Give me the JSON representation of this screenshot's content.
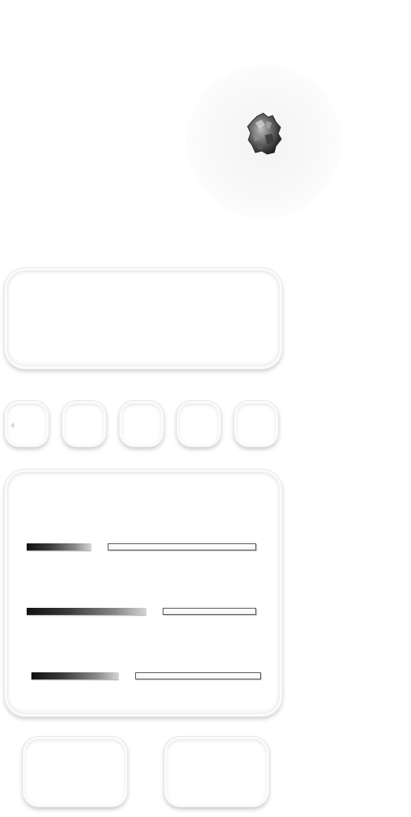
{
  "sliders": [
    {
      "id": "slider-1",
      "value": 0.28
    },
    {
      "id": "slider-2",
      "value": 0.52
    },
    {
      "id": "slider-3",
      "value": 0.38
    }
  ],
  "small_buttons": [
    {
      "id": "small-button-1"
    },
    {
      "id": "small-button-2"
    },
    {
      "id": "small-button-3"
    },
    {
      "id": "small-button-4"
    },
    {
      "id": "small-button-5"
    }
  ],
  "big_buttons": [
    {
      "id": "big-button-left"
    },
    {
      "id": "big-button-right"
    }
  ],
  "icons": {
    "rock": "rock-icon",
    "arrow": "arrow-left-icon"
  }
}
